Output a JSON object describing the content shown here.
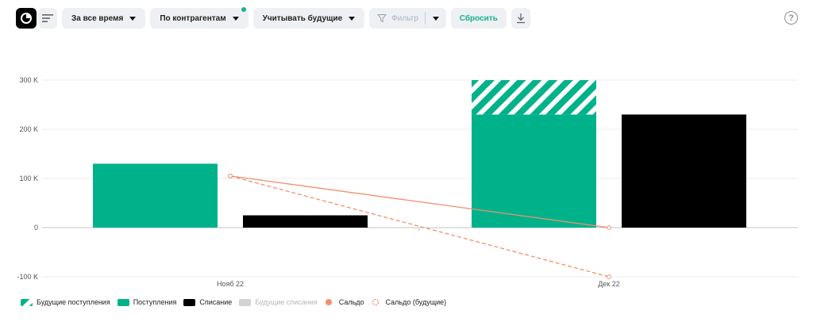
{
  "toolbar": {
    "period": "За все время",
    "group": "По контрагентам",
    "future": "Учитывать будущие",
    "filter": "Фильтр",
    "reset": "Сбросить"
  },
  "help": "?",
  "colors": {
    "income": "#00b28a",
    "expense": "#000000",
    "future_expense": "#c6c6c6",
    "balance": "#f09070",
    "accent": "#16b48b"
  },
  "chart_data": {
    "type": "bar",
    "categories": [
      "Нояб 22",
      "Дек 22"
    ],
    "ylim": [
      -100000,
      300000
    ],
    "yticks": [
      {
        "value": 300000,
        "label": "300 K"
      },
      {
        "value": 200000,
        "label": "200 K"
      },
      {
        "value": 100000,
        "label": "100 K"
      },
      {
        "value": 0,
        "label": "0"
      },
      {
        "value": -100000,
        "label": "-100 K"
      }
    ],
    "grid": true,
    "series": [
      {
        "name": "Будущие поступления",
        "kind": "bar",
        "stack": "income",
        "pattern": "hatch",
        "values": [
          0,
          70000
        ]
      },
      {
        "name": "Поступления",
        "kind": "bar",
        "stack": "income",
        "values": [
          130000,
          230000
        ]
      },
      {
        "name": "Списание",
        "kind": "bar",
        "stack": "expense",
        "values": [
          25000,
          230000
        ]
      },
      {
        "name": "Будущие списания",
        "kind": "bar",
        "stack": "expense",
        "hidden": true,
        "values": [
          0,
          0
        ]
      },
      {
        "name": "Сальдо",
        "kind": "line",
        "values": [
          105000,
          0
        ]
      },
      {
        "name": "Сальдо (будущие)",
        "kind": "line",
        "dashed": true,
        "values": [
          105000,
          -100000
        ]
      }
    ],
    "legend_position": "bottom-left"
  }
}
